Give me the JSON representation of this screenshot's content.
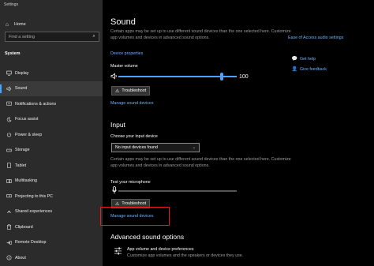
{
  "window": {
    "title": "Settings"
  },
  "sidebar": {
    "home_label": "Home",
    "search_placeholder": "Find a setting",
    "section_label": "System",
    "items": [
      {
        "label": "Display",
        "icon": "display-icon"
      },
      {
        "label": "Sound",
        "icon": "speaker-icon",
        "active": true
      },
      {
        "label": "Notifications & actions",
        "icon": "notifications-icon"
      },
      {
        "label": "Focus assist",
        "icon": "moon-icon"
      },
      {
        "label": "Power & sleep",
        "icon": "power-icon"
      },
      {
        "label": "Storage",
        "icon": "storage-icon"
      },
      {
        "label": "Tablet",
        "icon": "tablet-icon"
      },
      {
        "label": "Multitasking",
        "icon": "multitasking-icon"
      },
      {
        "label": "Projecting to this PC",
        "icon": "projecting-icon"
      },
      {
        "label": "Shared experiences",
        "icon": "shared-experiences-icon"
      },
      {
        "label": "Clipboard",
        "icon": "clipboard-icon"
      },
      {
        "label": "Remote Desktop",
        "icon": "remote-desktop-icon"
      },
      {
        "label": "About",
        "icon": "info-icon"
      }
    ]
  },
  "main": {
    "title": "Sound",
    "output_desc": "Certain apps may be set up to use different sound devices than the one selected here. Customize app volumes and devices in advanced sound options.",
    "device_properties": "Device properties",
    "master_volume_label": "Master volume",
    "master_volume_value": "100",
    "troubleshoot_label": "Troubleshoot",
    "manage_sound_devices": "Manage sound devices",
    "input_heading": "Input",
    "choose_input_label": "Choose your input device",
    "input_device_value": "No input devices found",
    "input_desc": "Certain apps may be set up to use different sound devices than the one selected here. Customize app volumes and devices in advanced sound options.",
    "test_mic_label": "Test your microphone",
    "input_troubleshoot_label": "Troubleshoot",
    "input_manage_sound_devices": "Manage sound devices",
    "advanced_heading": "Advanced sound options",
    "app_volume_title": "App volume and device preferences",
    "app_volume_desc": "Customize app volumes and the speakers or devices they use."
  },
  "related": {
    "ease_of_access_link": "Ease of Access audio settings",
    "get_help": "Get help",
    "give_feedback": "Give feedback"
  },
  "colors": {
    "accent": "#4aa3ff",
    "highlight": "#e01e1e",
    "sidebar_bg": "#2b2b2b"
  }
}
